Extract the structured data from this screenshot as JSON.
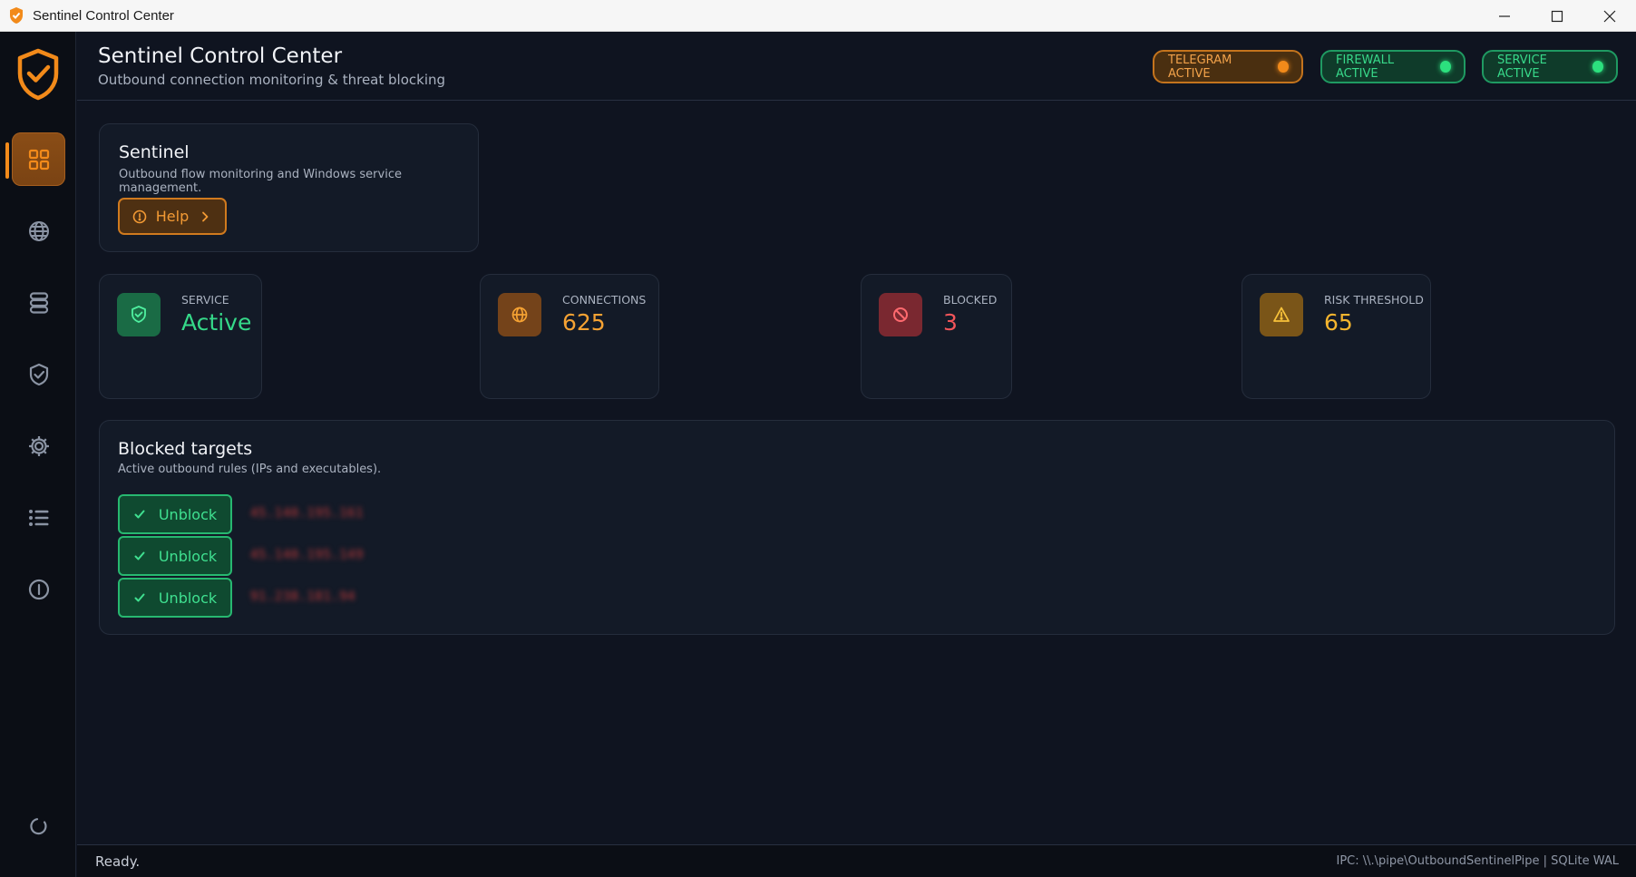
{
  "window": {
    "title": "Sentinel Control Center",
    "controls": [
      "minimize-icon",
      "maximize-icon",
      "close-icon"
    ]
  },
  "sidebar": {
    "logo": "shield-check-icon",
    "items": [
      {
        "icon": "dashboard-grid-icon",
        "active": true
      },
      {
        "icon": "globe-icon",
        "active": false
      },
      {
        "icon": "database-icon",
        "active": false
      },
      {
        "icon": "shield-check-icon",
        "active": false
      },
      {
        "icon": "gear-icon",
        "active": false
      },
      {
        "icon": "list-icon",
        "active": false
      },
      {
        "icon": "info-icon",
        "active": false
      }
    ],
    "bottom_icon": "refresh-icon"
  },
  "header": {
    "title": "Sentinel Control Center",
    "subtitle": "Outbound connection monitoring & threat blocking",
    "pills": [
      {
        "label": "TELEGRAM ACTIVE",
        "color": "#f28a1a"
      },
      {
        "label": "FIREWALL ACTIVE",
        "color": "#2ce07e"
      },
      {
        "label": "SERVICE ACTIVE",
        "color": "#2ce07e"
      }
    ]
  },
  "intro": {
    "title": "Sentinel",
    "subtitle": "Outbound flow monitoring and Windows service management.",
    "help_label": "Help"
  },
  "stats": {
    "service": {
      "label": "SERVICE",
      "value": "Active",
      "color": "#35d989",
      "icon": "shield-check-icon"
    },
    "connections": {
      "label": "CONNECTIONS",
      "value": "625",
      "color": "#f5a233",
      "icon": "globe-icon"
    },
    "blocked": {
      "label": "BLOCKED",
      "value": "3",
      "color": "#f2555a",
      "icon": "block-icon"
    },
    "risk": {
      "label": "RISK THRESHOLD",
      "value": "65",
      "color": "#f5b52e",
      "icon": "warning-icon"
    }
  },
  "blocked_targets": {
    "title": "Blocked targets",
    "subtitle": "Active outbound rules (IPs and executables).",
    "rows": [
      {
        "button_label": "Unblock",
        "target": "45.140.195.161"
      },
      {
        "button_label": "Unblock",
        "target": "45.140.195.149"
      },
      {
        "button_label": "Unblock",
        "target": "91.238.181.94"
      }
    ]
  },
  "statusbar": {
    "left": "Ready.",
    "right": "IPC: \\\\.\\pipe\\OutboundSentinelPipe | SQLite WAL"
  }
}
